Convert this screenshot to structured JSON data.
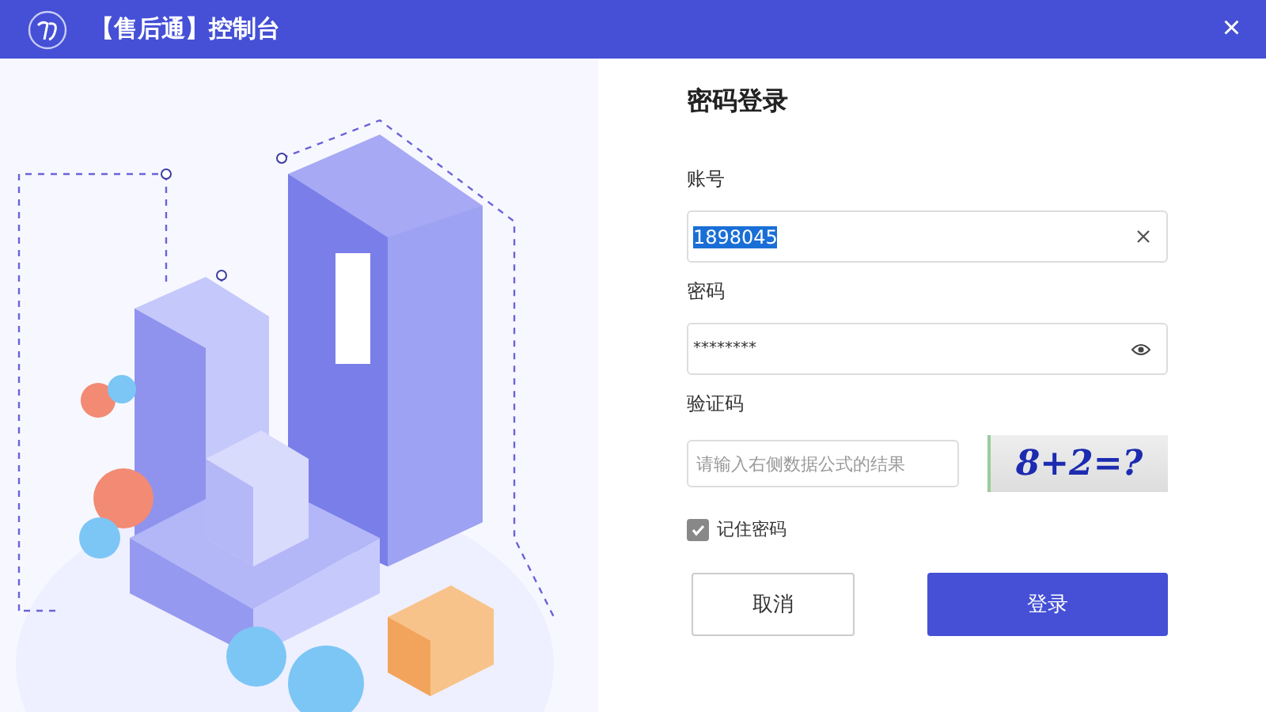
{
  "window": {
    "title": "【售后通】控制台",
    "close": "×"
  },
  "form": {
    "heading": "密码登录",
    "account": {
      "label": "账号",
      "value": "1898045",
      "selected": true
    },
    "password": {
      "label": "密码",
      "value": "********"
    },
    "captcha": {
      "label": "验证码",
      "placeholder": "请输入右侧数据公式的结果",
      "image_text": "8+2=?"
    },
    "remember": {
      "label": "记住密码",
      "checked": true
    },
    "buttons": [
      {
        "kind": "secondary",
        "label": "取消"
      },
      {
        "kind": "primary",
        "label": "登录"
      }
    ]
  }
}
